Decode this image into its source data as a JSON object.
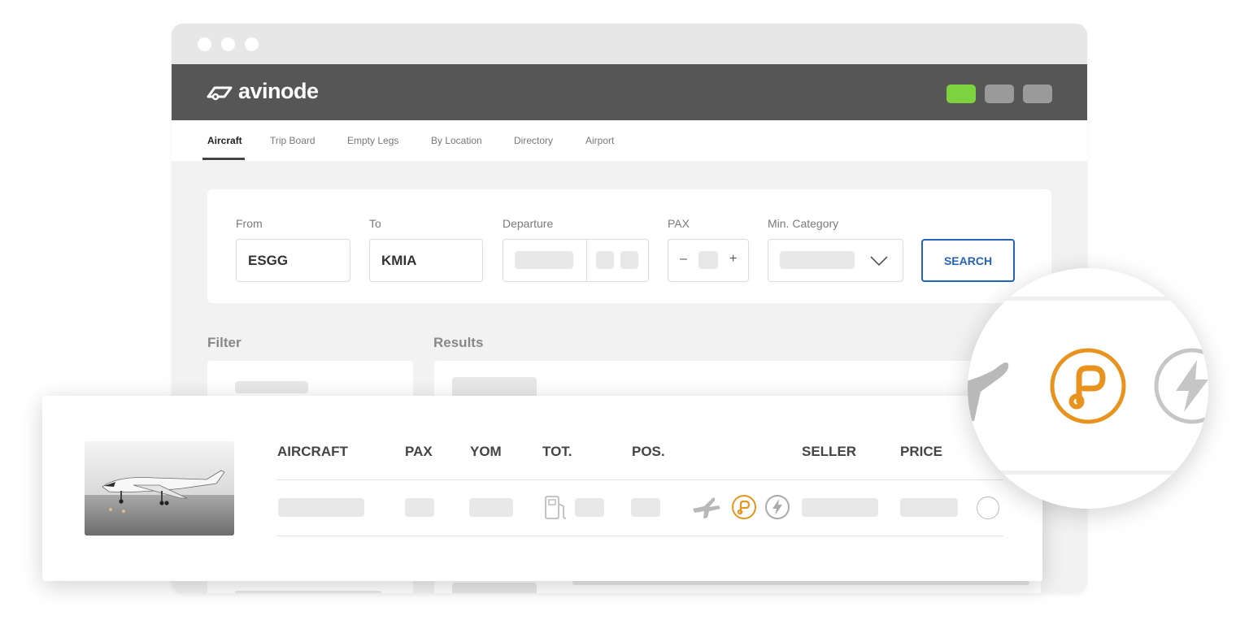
{
  "app": {
    "brand": "avinode"
  },
  "tabs": [
    {
      "label": "Aircraft",
      "active": true
    },
    {
      "label": "Trip Board",
      "active": false
    },
    {
      "label": "Empty Legs",
      "active": false
    },
    {
      "label": "By Location",
      "active": false
    },
    {
      "label": "Directory",
      "active": false
    },
    {
      "label": "Airport",
      "active": false
    }
  ],
  "search": {
    "from_label": "From",
    "from_value": "ESGG",
    "to_label": "To",
    "to_value": "KMIA",
    "departure_label": "Departure",
    "pax_label": "PAX",
    "pax_minus": "–",
    "pax_plus": "+",
    "category_label": "Min. Category",
    "search_button": "SEARCH"
  },
  "sections": {
    "filter": "Filter",
    "results": "Results"
  },
  "results_table": {
    "columns": [
      "AIRCRAFT",
      "PAX",
      "YOM",
      "TOT.",
      "POS.",
      "SELLER",
      "PRICE"
    ]
  },
  "icons": [
    "avinode-logo-icon",
    "fuel-pump-icon",
    "plane-icon",
    "p-badge-icon",
    "lightning-icon",
    "chevron-down-icon"
  ],
  "colors": {
    "header_bg": "#565656",
    "accent_green": "#7dd33f",
    "accent_orange": "#e8931e",
    "link_blue": "#2563b8"
  }
}
